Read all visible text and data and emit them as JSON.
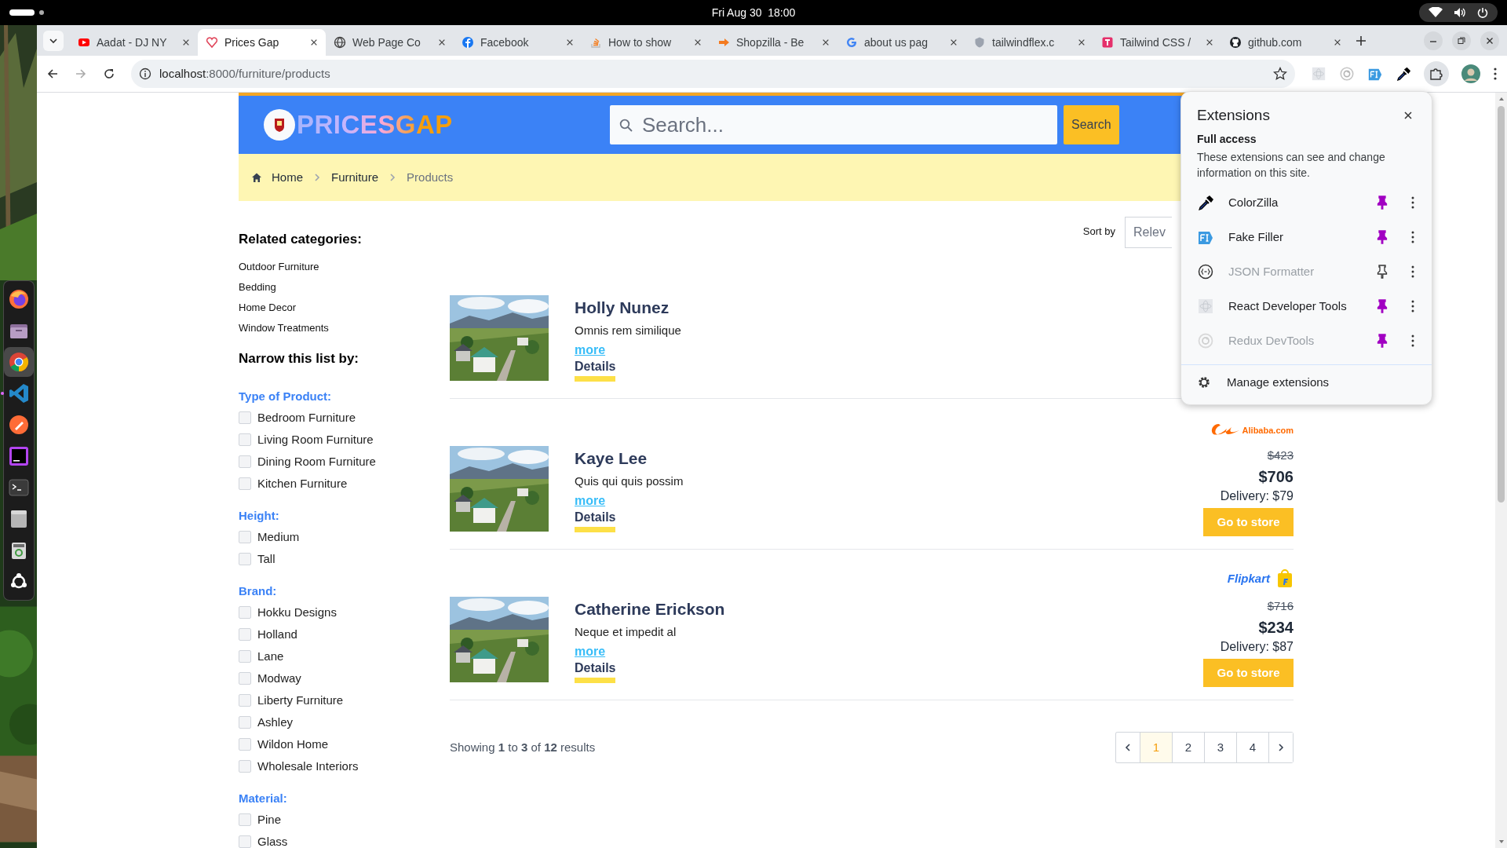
{
  "system_bar": {
    "clock": "Fri Aug 30  18:00"
  },
  "dock": {
    "apps": [
      {
        "kind": "firefox",
        "running": false,
        "focused": false
      },
      {
        "kind": "files",
        "running": false,
        "focused": false
      },
      {
        "kind": "chrome",
        "running": false,
        "focused": true
      },
      {
        "kind": "vscode",
        "running": true,
        "focused": false
      },
      {
        "kind": "postman",
        "running": false,
        "focused": false
      },
      {
        "kind": "phpstorm",
        "running": false,
        "focused": false
      },
      {
        "kind": "terminal",
        "running": false,
        "focused": false
      },
      {
        "kind": "drive",
        "running": false,
        "focused": false
      },
      {
        "kind": "trash",
        "running": false,
        "focused": false
      },
      {
        "kind": "apps",
        "running": false,
        "focused": false
      }
    ]
  },
  "browser": {
    "tabs": [
      {
        "title": "Aadat - DJ NY",
        "kind": "play",
        "selected": false
      },
      {
        "title": "Prices Gap",
        "kind": "heart",
        "selected": true
      },
      {
        "title": "Web Page Co",
        "kind": "globe",
        "selected": false
      },
      {
        "title": "Facebook",
        "kind": "fcircle",
        "selected": false
      },
      {
        "title": "How to show",
        "kind": "stack",
        "selected": false
      },
      {
        "title": "Shopzilla - Be",
        "kind": "arrow",
        "selected": false
      },
      {
        "title": "about us pag",
        "kind": "gletter",
        "selected": false
      },
      {
        "title": "tailwindflex.c",
        "kind": "shield",
        "selected": false
      },
      {
        "title": "Tailwind CSS /",
        "kind": "tsquare",
        "selected": false
      },
      {
        "title": "github.com",
        "kind": "cat",
        "selected": false
      }
    ],
    "url": {
      "host": "localhost",
      "path": ":8000/furniture/products"
    },
    "extensions_button_active": true
  },
  "site": {
    "logo": "PRICESGAP",
    "search": {
      "placeholder": "Search...",
      "button": "Search"
    },
    "breadcrumbs": [
      {
        "label": "Home",
        "current": false
      },
      {
        "label": "Furniture",
        "current": false
      },
      {
        "label": "Products",
        "current": true
      }
    ]
  },
  "sidebar": {
    "related_title": "Related categories:",
    "related": [
      "Outdoor Furniture",
      "Bedding",
      "Home Decor",
      "Window Treatments"
    ],
    "narrow_title": "Narrow this list by:",
    "filters": [
      {
        "title": "Type of Product:",
        "options": [
          {
            "label": "Bedroom Furniture",
            "checked": false
          },
          {
            "label": "Living Room Furniture",
            "checked": false
          },
          {
            "label": "Dining Room Furniture",
            "checked": false
          },
          {
            "label": "Kitchen Furniture",
            "checked": false
          }
        ]
      },
      {
        "title": "Height:",
        "options": [
          {
            "label": "Medium",
            "checked": false
          },
          {
            "label": "Tall",
            "checked": false
          }
        ]
      },
      {
        "title": "Brand:",
        "options": [
          {
            "label": "Hokku Designs",
            "checked": false
          },
          {
            "label": "Holland",
            "checked": false
          },
          {
            "label": "Lane",
            "checked": false
          },
          {
            "label": "Modway",
            "checked": false
          },
          {
            "label": "Liberty Furniture",
            "checked": false
          },
          {
            "label": "Ashley",
            "checked": false
          },
          {
            "label": "Wildon Home",
            "checked": false
          },
          {
            "label": "Wholesale Interiors",
            "checked": false
          }
        ]
      },
      {
        "title": "Material:",
        "options": [
          {
            "label": "Pine",
            "checked": false
          },
          {
            "label": "Glass",
            "checked": false
          }
        ]
      }
    ]
  },
  "sort": {
    "label": "Sort by",
    "value": "Relev"
  },
  "products": [
    {
      "title": "Holly Nunez",
      "description": "Omnis rem similique",
      "more": "more",
      "details": "Details"
    },
    {
      "title": "Kaye Lee",
      "description": "Quis qui quis possim",
      "more": "more",
      "details": "Details",
      "offer": {
        "store": {
          "kind": "swoosh",
          "name": "Alibaba.com"
        },
        "old_price": "$423",
        "price": "$706",
        "delivery": "Delivery: $79",
        "button": "Go to store"
      }
    },
    {
      "title": "Catherine Erickson",
      "description": "Neque et impedit al",
      "more": "more",
      "details": "Details",
      "offer": {
        "store": {
          "kind": "bag",
          "name": "Flipkart"
        },
        "old_price": "$716",
        "price": "$234",
        "delivery": "Delivery: $87",
        "button": "Go to store"
      }
    }
  ],
  "pagination": {
    "summary": "Showing **1** to **3** of **12** results",
    "pages": [
      {
        "label": "1",
        "selected": true
      },
      {
        "label": "2",
        "selected": false
      },
      {
        "label": "3",
        "selected": false
      },
      {
        "label": "4",
        "selected": false
      }
    ]
  },
  "extensions_popup": {
    "title": "Extensions",
    "section": "Full access",
    "description": "These extensions can see and change information on this site.",
    "items": [
      {
        "name": "ColorZilla",
        "kind": "eyedropper",
        "pinned": true,
        "disabled": false
      },
      {
        "name": "Fake Filler",
        "kind": "ffbadge",
        "pinned": true,
        "disabled": false
      },
      {
        "name": "JSON Formatter",
        "kind": "braces",
        "pinned": false,
        "disabled": true
      },
      {
        "name": "React Developer Tools",
        "kind": "atom",
        "pinned": true,
        "disabled": false
      },
      {
        "name": "Redux DevTools",
        "kind": "target",
        "pinned": true,
        "disabled": true
      }
    ],
    "manage": "Manage extensions"
  }
}
